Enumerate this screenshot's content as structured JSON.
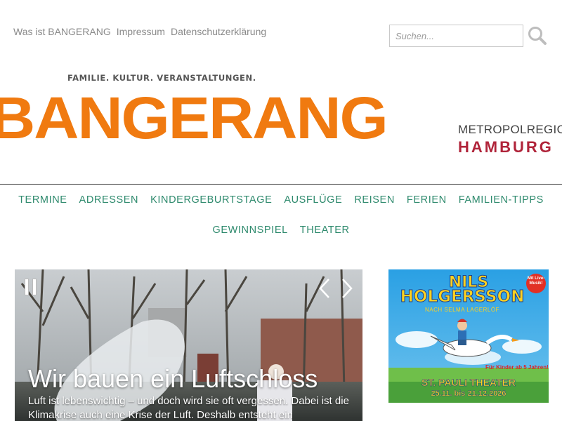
{
  "header": {
    "top_links": [
      "Was ist BANGERANG",
      "Impressum",
      "Datenschutzerklärung"
    ],
    "search": {
      "placeholder": "Suchen...",
      "value": "",
      "icon": "search-icon"
    },
    "tagline": "FAMILIE.  KULTUR.  VERANSTALTUNGEN.",
    "logo_text": "BANGERANG",
    "region": {
      "line1": "METROPOLREGION",
      "line2": "HAMBURG"
    }
  },
  "nav": {
    "items": [
      "TERMINE",
      "ADRESSEN",
      "KINDERGEBURTSTAGE",
      "AUSFLÜGE",
      "REISEN",
      "FERIEN",
      "FAMILIEN-TIPPS",
      "GEWINNSPIEL",
      "THEATER"
    ]
  },
  "slider": {
    "title": "Wir bauen ein Luftschloss",
    "text": "Luft ist lebenswichtig – und doch wird sie oft vergessen. Dabei ist die Klimakrise auch eine Krise der Luft. Deshalb entsteht ein",
    "controls": {
      "pause_icon": "pause-icon",
      "prev_icon": "chevron-left-icon",
      "next_icon": "chevron-right-icon"
    }
  },
  "ad": {
    "title_line1": "NILS",
    "title_line2": "HOLGERSSON",
    "subtitle": "NACH SELMA LAGERLÖF",
    "badge": "Mit Live-Musik!",
    "age_note": "Für Kinder ab 5 Jahren!",
    "venue": "ST. PAULI THEATER",
    "dates": "25.11. bis 21.12.2026"
  },
  "colors": {
    "brand_orange": "#f07a10",
    "nav_green": "#2e8a6d",
    "region_red": "#b0243a",
    "ad_sky": "#2ea3e6"
  }
}
